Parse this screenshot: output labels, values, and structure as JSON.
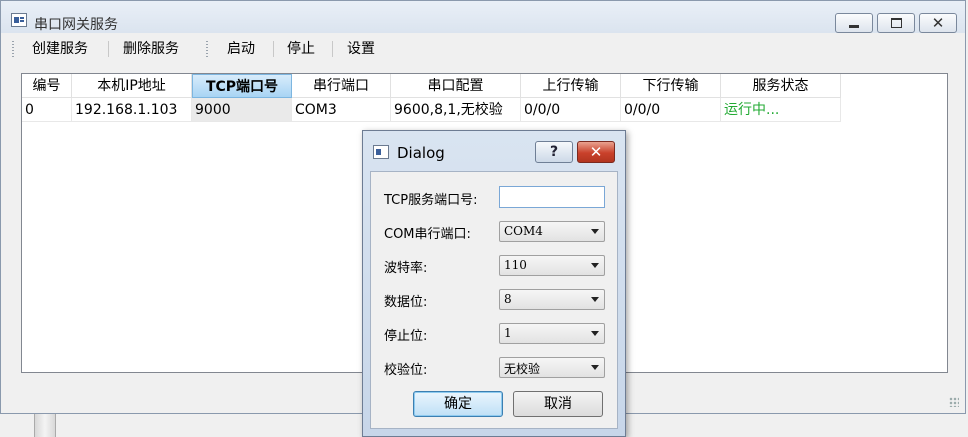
{
  "window": {
    "title": "串口网关服务"
  },
  "toolbar": {
    "create_service": "创建服务",
    "delete_service": "删除服务",
    "start": "启动",
    "stop": "停止",
    "settings": "设置"
  },
  "table": {
    "headers": [
      "编号",
      "本机IP地址",
      "TCP端口号",
      "串行端口",
      "串口配置",
      "上行传输",
      "下行传输",
      "服务状态"
    ],
    "rows": [
      [
        "0",
        "192.168.1.103",
        "9000",
        "COM3",
        "9600,8,1,无校验",
        "0/0/0",
        "0/0/0",
        "运行中..."
      ]
    ]
  },
  "colors": {
    "status_running": "#22aa33",
    "header_active": "#a8d4f4"
  },
  "dialog": {
    "title": "Dialog",
    "help_label": "?",
    "close_label": "✕",
    "tcp_port_label": "TCP服务端口号:",
    "tcp_port_value": "",
    "com_port_label": "COM串行端口:",
    "com_port_value": "COM4",
    "baud_label": "波特率:",
    "baud_value": "110",
    "data_bits_label": "数据位:",
    "data_bits_value": "8",
    "stop_bits_label": "停止位:",
    "stop_bits_value": "1",
    "parity_label": "校验位:",
    "parity_value": "无校验",
    "ok_label": "确定",
    "cancel_label": "取消"
  }
}
